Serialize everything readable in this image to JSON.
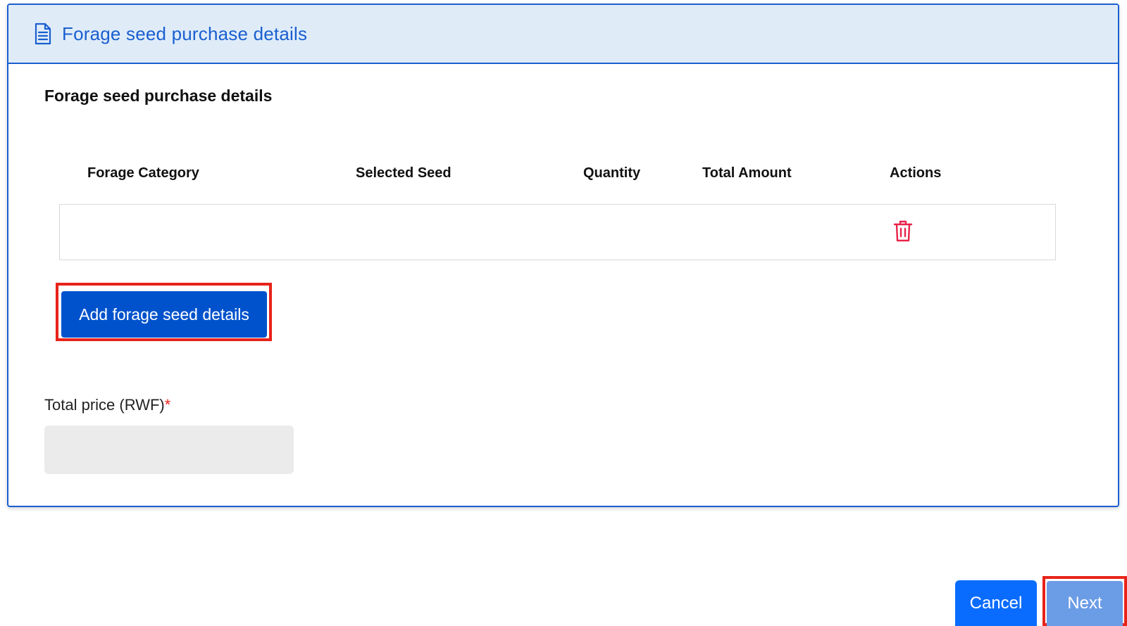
{
  "card": {
    "header_title": "Forage seed purchase details",
    "header_icon": "document-icon",
    "section_title": "Forage seed purchase details"
  },
  "table": {
    "columns": [
      "Forage Category",
      "Selected Seed",
      "Quantity",
      "Total Amount",
      "Actions"
    ],
    "rows": [
      {
        "forage_category": "",
        "selected_seed": "",
        "quantity": "",
        "total_amount": "",
        "action_icon": "trash-icon"
      }
    ]
  },
  "add_button_label": "Add forage seed details",
  "total_price": {
    "label": "Total price (RWF)",
    "required_mark": "*",
    "value": ""
  },
  "footer": {
    "cancel_label": "Cancel",
    "next_label": "Next"
  },
  "colors": {
    "accent": "#1a5fd0",
    "header_bg": "#dfecf8",
    "primary_button": "#0052cc",
    "cancel_button": "#0a6cff",
    "next_button_disabled": "#6b9ce6",
    "delete_icon": "#e8234a",
    "highlight_outline": "#e8231a"
  }
}
